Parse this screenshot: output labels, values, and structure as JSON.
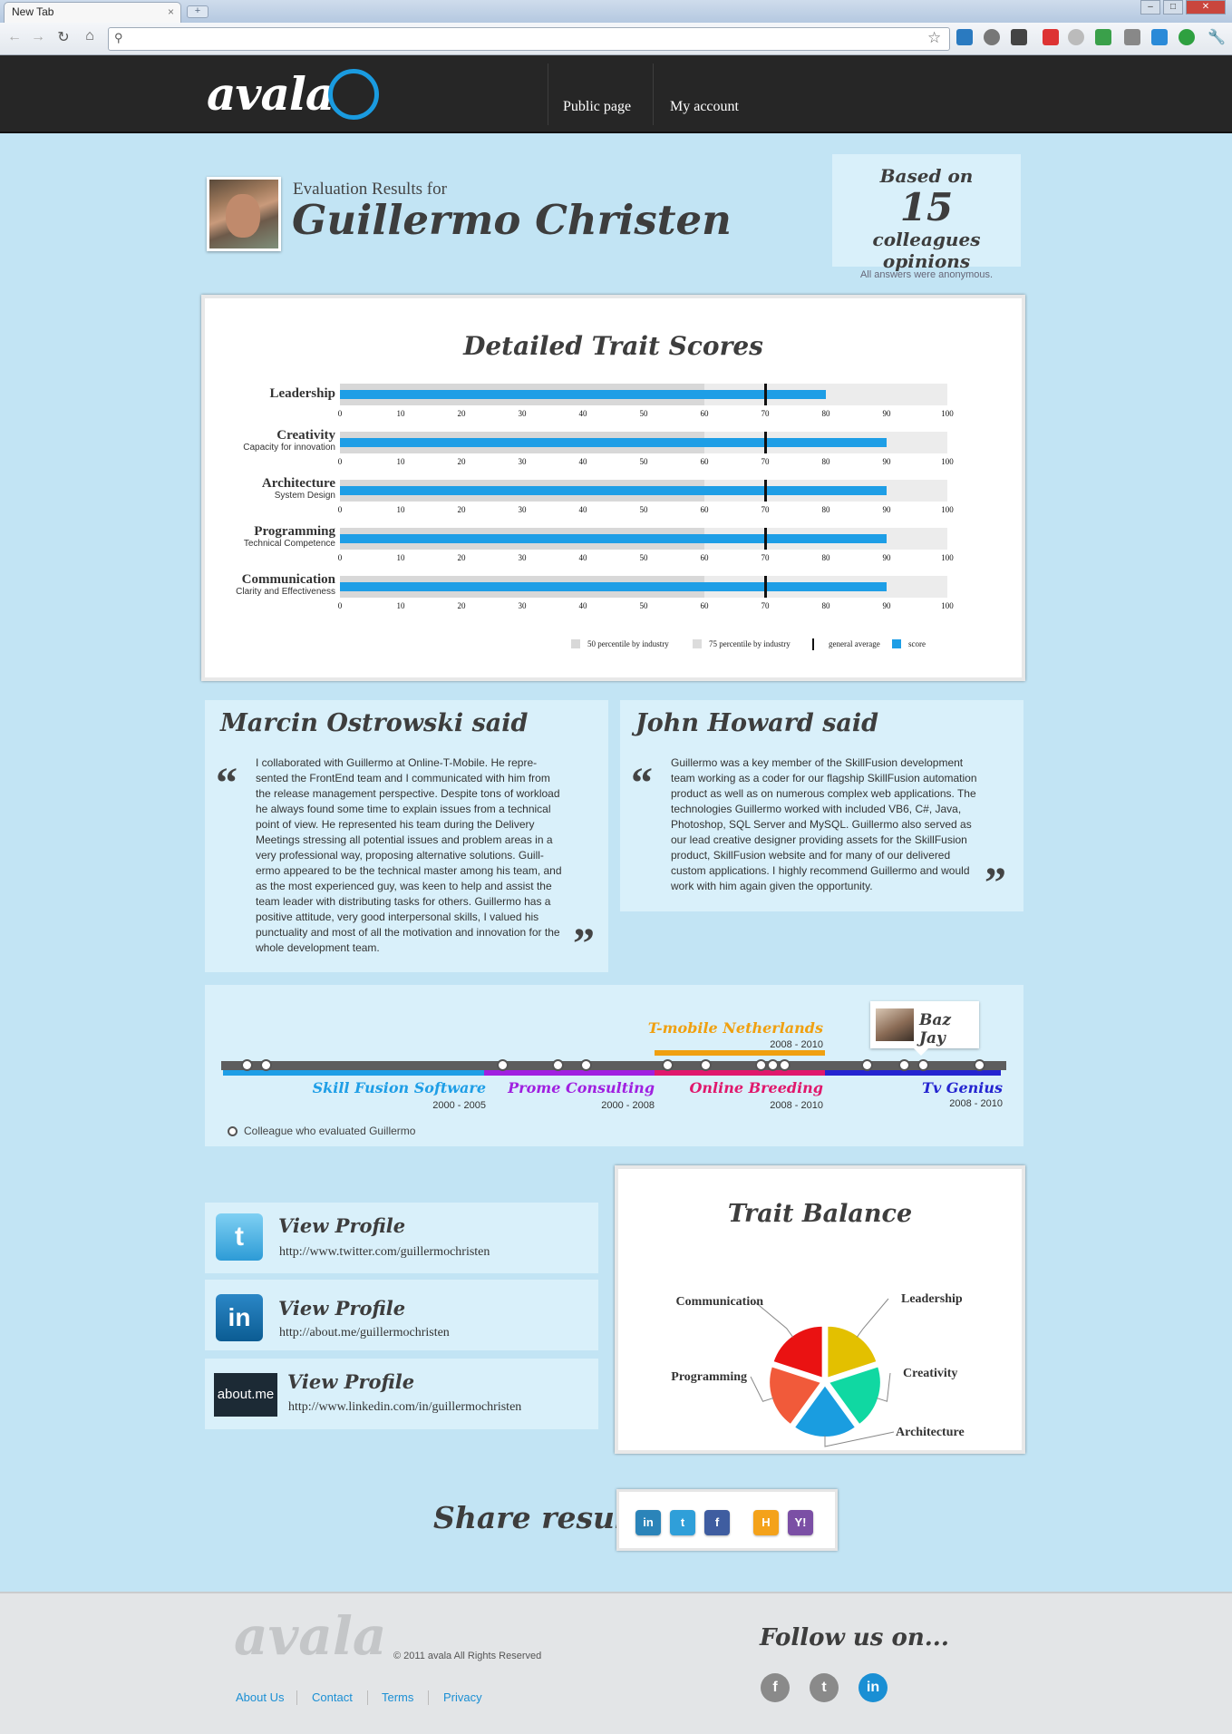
{
  "browser": {
    "tab_title": "New Tab",
    "tab_close": "×",
    "new_tab": "+",
    "window_buttons": [
      "‒",
      "□",
      "✕"
    ]
  },
  "site": {
    "logo": "avala",
    "nav": [
      "Public page",
      "My account"
    ]
  },
  "profile": {
    "eval_for": "Evaluation Results for",
    "name": "Guillermo Christen",
    "based_on": "Based on",
    "count": "15",
    "count_suffix": "colleagues opinions",
    "anonymous_note": "All answers were anonymous."
  },
  "chart_data": [
    {
      "type": "bar",
      "title": "Detailed Trait Scores",
      "categories": [
        "Leadership",
        "Creativity",
        "Architecture",
        "Programming",
        "Communication"
      ],
      "category_subtitles": [
        "",
        "Capacity for innovation",
        "System Design",
        "Technical Competence",
        "Clarity and Effectiveness"
      ],
      "series": [
        {
          "name": "50 percentile by industry",
          "values": [
            60,
            60,
            60,
            60,
            60
          ]
        },
        {
          "name": "75 percentile by industry",
          "values": [
            100,
            100,
            100,
            100,
            100
          ]
        },
        {
          "name": "general average",
          "values": [
            70,
            70,
            70,
            70,
            70
          ]
        },
        {
          "name": "score",
          "values": [
            80,
            90,
            90,
            90,
            90
          ]
        }
      ],
      "xlim": [
        0,
        100
      ],
      "ticks": [
        "0",
        "10",
        "20",
        "30",
        "40",
        "50",
        "60",
        "70",
        "80",
        "90",
        "100"
      ],
      "colors": {
        "p50": "#d8d8d8",
        "p75": "#ececec",
        "average": "#111111",
        "score": "#1e9ee6"
      },
      "legend_position": "bottom-right"
    },
    {
      "type": "pie",
      "title": "Trait Balance",
      "categories": [
        "Leadership",
        "Creativity",
        "Architecture",
        "Programming",
        "Communication"
      ],
      "values": [
        20,
        20,
        20,
        20,
        20
      ],
      "colors": [
        "#e3c000",
        "#10d8a2",
        "#1a9de0",
        "#f15a3a",
        "#ea1212"
      ]
    }
  ],
  "testimonials": [
    {
      "title": "Marcin Ostrowski said",
      "lines": [
        "I collaborated with Guillermo at Online-T-Mobile. He repre-",
        "sented the FrontEnd team and I communicated with him from",
        "the release management perspective. Despite tons of workload",
        "he always found some time to explain issues from a technical",
        "point of view. He represented his team during the Delivery",
        "Meetings stressing all potential issues and problem areas in a",
        "very professional way, proposing alternative solutions. Guill-",
        "ermo appeared to be the technical master among his team, and",
        "as the most experienced guy, was keen to help and assist the",
        "team leader with distributing tasks for others. Guillermo has a",
        "positive attitude, very good interpersonal skills, I valued his",
        "punctuality and most of all the motivation and innovation for the",
        "whole development team."
      ]
    },
    {
      "title": "John Howard said",
      "lines": [
        "Guillermo was a key member of the SkillFusion development",
        "team working as a coder for our flagship SkillFusion automation",
        "product as well as on numerous complex web applications. The",
        "technologies Guillermo worked with included VB6, C#, Java,",
        "Photoshop, SQL Server and MySQL. Guillermo also served as",
        "our lead creative designer providing assets for the SkillFusion",
        "product, SkillFusion website and for many of our delivered",
        "custom applications. I highly recommend Guillermo and would",
        "work with him again given the opportunity."
      ]
    }
  ],
  "quote_marks": {
    "open": "“",
    "close": "”"
  },
  "timeline": {
    "companies": [
      {
        "name": "Skill Fusion Software",
        "years": "2000 - 2005",
        "color": "#1e9ee6"
      },
      {
        "name": "Prome Consulting",
        "years": "2000 - 2008",
        "color": "#a020e0"
      },
      {
        "name": "T-mobile Netherlands",
        "years": "2008 - 2010",
        "color": "#f0a010"
      },
      {
        "name": "Online Breeding",
        "years": "2008 - 2010",
        "color": "#e0186c"
      },
      {
        "name": "Tv Genius",
        "years": "2008 - 2010",
        "color": "#2424d0"
      }
    ],
    "popup_name": "Baz Jay",
    "legend": "Colleague who evaluated Guillermo"
  },
  "social": [
    {
      "title": "View Profile",
      "url": "http://www.twitter.com/guillermochristen",
      "icon": "twitter-icon",
      "icon_text": "t",
      "color": "#47b2e6"
    },
    {
      "title": "View Profile",
      "url": "http://about.me/guillermochristen",
      "icon": "linkedin-icon",
      "icon_text": "in",
      "color": "#0d69a8"
    },
    {
      "title": "View Profile",
      "url": "http://www.linkedin.com/in/guillermochristen",
      "icon": "aboutme-icon",
      "icon_text": "about.me",
      "color": "#1c2a35"
    }
  ],
  "share": {
    "label": "Share results",
    "icons": [
      {
        "name": "linkedin",
        "text": "in",
        "color": "#2b84b9"
      },
      {
        "name": "twitter",
        "text": "t",
        "color": "#2f9fd9"
      },
      {
        "name": "facebook",
        "text": "f",
        "color": "#3f5da0"
      },
      {
        "name": "hyves",
        "text": "H",
        "color": "#f4a21a"
      },
      {
        "name": "yahoo",
        "text": "Y!",
        "color": "#7b4fa5"
      }
    ]
  },
  "footer": {
    "logo": "avala",
    "copyright": "© 2011 avala All Rights Reserved",
    "links": [
      "About Us",
      "Contact",
      "Terms",
      "Privacy"
    ],
    "follow": "Follow us on...",
    "social": [
      "f",
      "t",
      "in"
    ],
    "link_color": "#1a8fd4"
  }
}
